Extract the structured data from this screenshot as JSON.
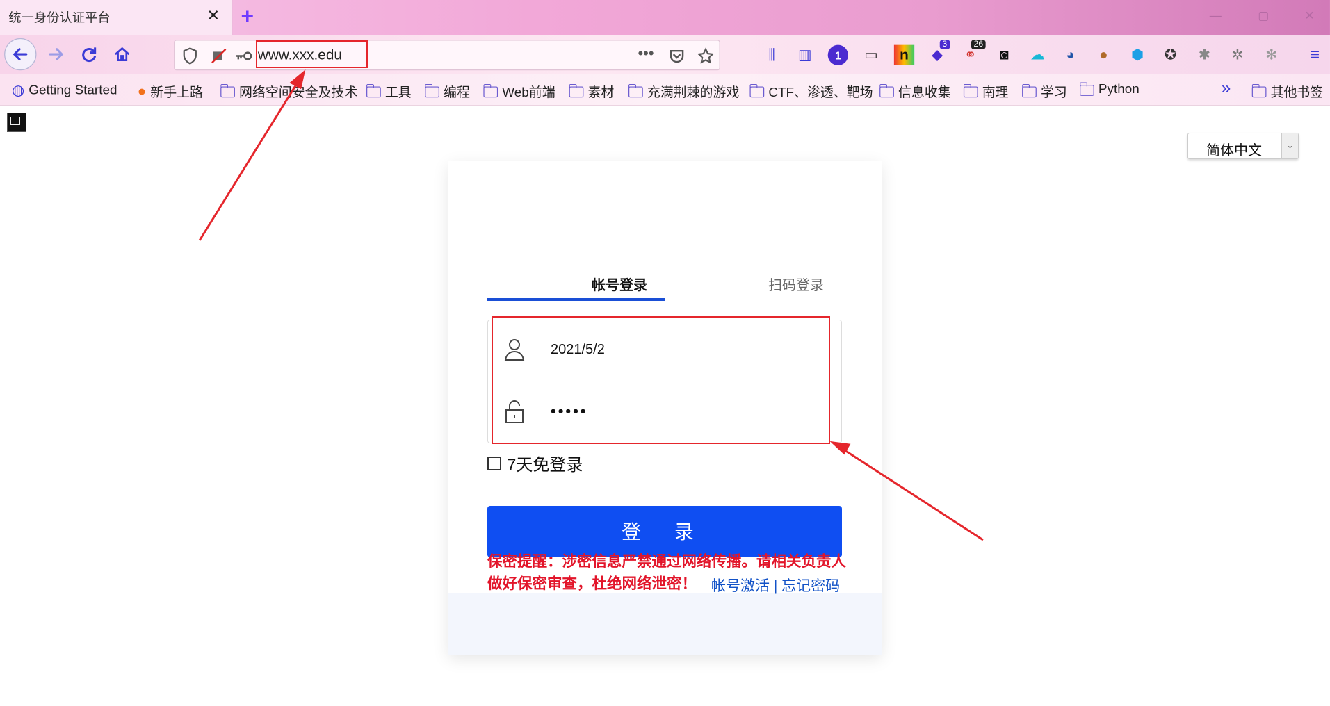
{
  "browser": {
    "tab_title": "统一身份认证平台",
    "tab_close": "✕",
    "new_tab": "+",
    "window_controls": [
      "—",
      "▢",
      "✕"
    ],
    "url": "www.xxx.edu",
    "badges": {
      "ext_badge_1": "3",
      "ext_badge_2": "26"
    },
    "bookmarks": [
      {
        "label": "Getting Started",
        "icon": "globe-icon"
      },
      {
        "label": "新手上路",
        "icon": "firefox-icon"
      },
      {
        "label": "网络空间安全及技术",
        "icon": "folder-icon"
      },
      {
        "label": "工具",
        "icon": "folder-icon"
      },
      {
        "label": "编程",
        "icon": "folder-icon"
      },
      {
        "label": "Web前端",
        "icon": "folder-icon"
      },
      {
        "label": "素材",
        "icon": "folder-icon"
      },
      {
        "label": "充满荆棘的游戏",
        "icon": "folder-icon"
      },
      {
        "label": "CTF、渗透、靶场",
        "icon": "folder-icon"
      },
      {
        "label": "信息收集",
        "icon": "folder-icon"
      },
      {
        "label": "南理",
        "icon": "folder-icon"
      },
      {
        "label": "学习",
        "icon": "folder-icon"
      },
      {
        "label": "Python",
        "icon": "folder-icon"
      }
    ],
    "bookmarks_overflow": "»",
    "other_bookmarks": "其他书签"
  },
  "page": {
    "language": "简体中文",
    "tabs": {
      "account": "帐号登录",
      "qrcode": "扫码登录"
    },
    "username_value": "2021/5/2",
    "password_value": "•••••",
    "remember_label": "7天免登录",
    "login_button": "登 录",
    "warning": "保密提醒：涉密信息严禁通过网络传播。请相关负责人做好保密审查，杜绝网络泄密！",
    "activate_link": "帐号激活",
    "separator": "|",
    "forgot_link": "忘记密码"
  },
  "colors": {
    "primary_blue": "#0f4ef2",
    "annotation_red": "#e5262c",
    "warning_red": "#e2152a"
  }
}
